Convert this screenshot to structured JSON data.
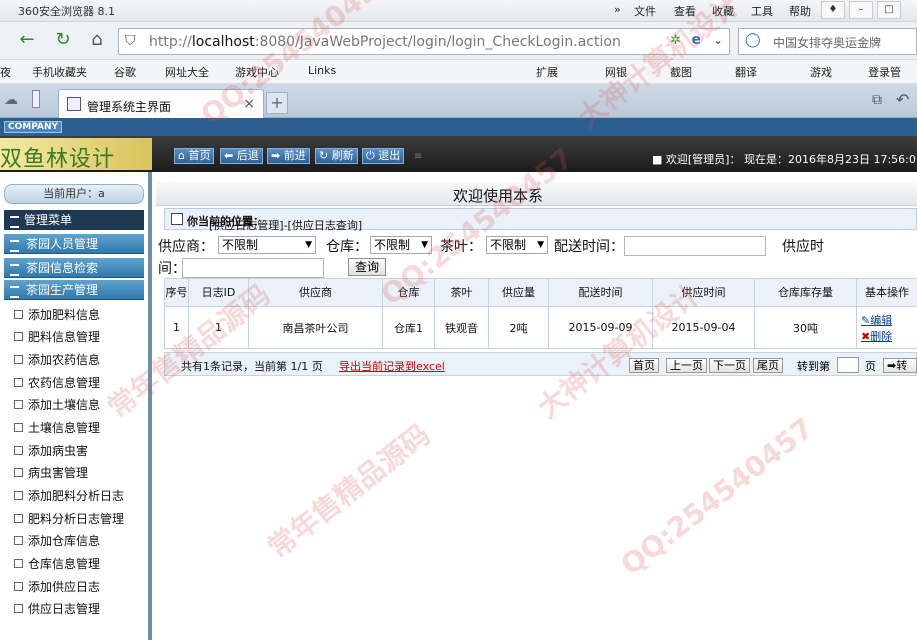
{
  "browser": {
    "title": "360安全浏览器 8.1",
    "menu": [
      "文件",
      "查看",
      "收藏",
      "工具",
      "帮助"
    ],
    "address_host": "localhost",
    "address_prefix": "http://",
    "address_rest": ":8080/JavaWebProject/login/login_CheckLogin.action",
    "search_text": "中国女排夺奥运金牌",
    "favorites": [
      "手机收藏夹",
      "谷歌",
      "网址大全",
      "游戏中心",
      "Links",
      "扩展",
      "网银",
      "截图",
      "翻译",
      "游戏",
      "登录管"
    ],
    "tab_title": "管理系统主界面"
  },
  "app": {
    "company": "COMPANY",
    "logo_text": "双鱼林设计",
    "toolbar": [
      "首页",
      "后退",
      "前进",
      "刷新",
      "退出"
    ],
    "welcome": "■ 欢迎[管理员]：  现在是：2016年8月23日 17:56:0"
  },
  "sidebar": {
    "current_user": "当前用户：a",
    "menu_title": "管理菜单",
    "sections": [
      "茶园人员管理",
      "茶园信息检索",
      "茶园生产管理"
    ],
    "items": [
      "添加肥料信息",
      "肥料信息管理",
      "添加农药信息",
      "农药信息管理",
      "添加土壤信息",
      "土壤信息管理",
      "添加病虫害",
      "病虫害管理",
      "添加肥料分析日志",
      "肥料分析日志管理",
      "添加仓库信息",
      "仓库信息管理",
      "添加供应日志",
      "供应日志管理"
    ]
  },
  "content": {
    "page_title": "欢迎使用本系",
    "location_label": "你当前的位置：",
    "location_path": "[供应日志管理]-[供应日志查询]",
    "filters": {
      "supplier_label": "供应商：",
      "supplier_value": "不限制",
      "warehouse_label": "仓库：",
      "warehouse_value": "不限制",
      "tea_label": "茶叶：",
      "tea_value": "不限制",
      "delivery_label": "配送时间：",
      "supply_label": "供应时",
      "supply_label_wrap": "间：",
      "query_button": "查询"
    },
    "table": {
      "headers": [
        "序号",
        "日志ID",
        "供应商",
        "仓库",
        "茶叶",
        "供应量",
        "配送时间",
        "供应时间",
        "仓库库存量",
        "基本操作"
      ],
      "rows": [
        [
          "1",
          "1",
          "南昌茶叶公司",
          "仓库1",
          "铁观音",
          "2吨",
          "2015-09-09",
          "2015-09-04",
          "30吨"
        ]
      ],
      "edit": "编辑",
      "delete": "删除"
    },
    "pager": {
      "info": "共有1条记录，当前第 1/1 页",
      "export": "导出当前记录到excel",
      "first": "首页",
      "prev": "上一页",
      "next": "下一页",
      "last": "尾页",
      "goto_label": "转到第",
      "page_unit": "页",
      "go": "➡转"
    }
  },
  "watermarks": [
    "QQ:254540457",
    "常年售精品源码",
    "大神计算机设计"
  ]
}
